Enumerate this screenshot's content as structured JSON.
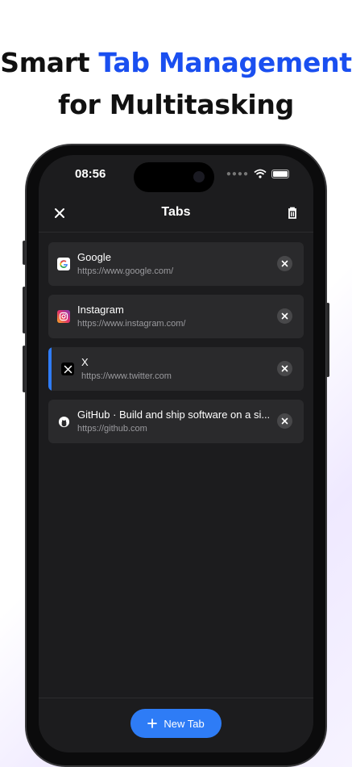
{
  "headline": {
    "line1_plain": "Smart ",
    "line1_accent": "Tab Management",
    "line2": "for Multitasking",
    "accent_color": "#1a4ff0"
  },
  "status_bar": {
    "time": "08:56",
    "icons": [
      "signal-dots-icon",
      "wifi-icon",
      "battery-icon"
    ]
  },
  "topbar": {
    "title": "Tabs",
    "left_icon": "close-icon",
    "right_icon": "trash-icon"
  },
  "tabs": [
    {
      "title": "Google",
      "url": "https://www.google.com/",
      "icon": "google-icon",
      "active": false
    },
    {
      "title": "Instagram",
      "url": "https://www.instagram.com/",
      "icon": "instagram-icon",
      "active": false
    },
    {
      "title": "X",
      "url": "https://www.twitter.com",
      "icon": "x-icon",
      "active": true
    },
    {
      "title": "GitHub · Build and ship software on a si...",
      "url": "https://github.com",
      "icon": "github-icon",
      "active": false
    }
  ],
  "bottom": {
    "new_tab_label": "New Tab",
    "button_color": "#2e7cf6"
  }
}
